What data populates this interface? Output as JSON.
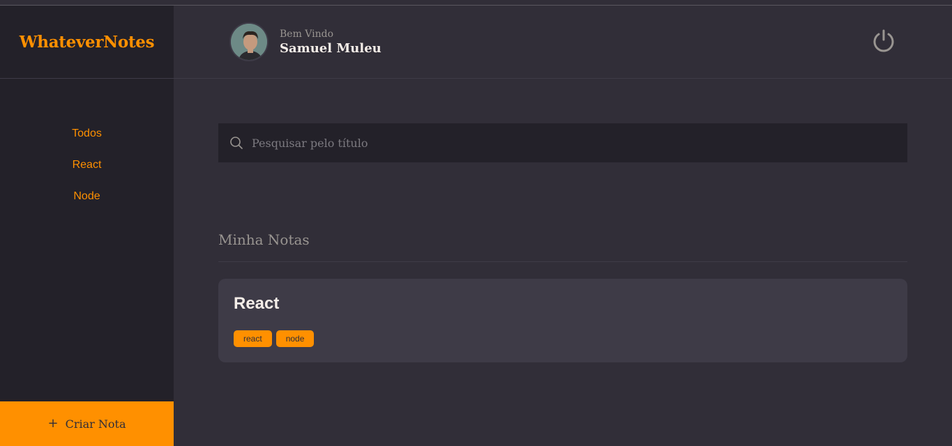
{
  "brand": {
    "name": "WhateverNotes"
  },
  "sidebar": {
    "items": [
      {
        "label": "Todos"
      },
      {
        "label": "React"
      },
      {
        "label": "Node"
      }
    ],
    "new_note_label": "Criar Nota"
  },
  "header": {
    "welcome": "Bem Vindo",
    "username": "Samuel Muleu"
  },
  "search": {
    "placeholder": "Pesquisar pelo título",
    "value": ""
  },
  "main": {
    "section_title": "Minha Notas",
    "notes": [
      {
        "title": "React",
        "tags": [
          "react",
          "node"
        ]
      }
    ]
  },
  "colors": {
    "accent": "#ff9000",
    "background": "#312e38",
    "panel": "#232129",
    "card": "#3e3b47"
  }
}
